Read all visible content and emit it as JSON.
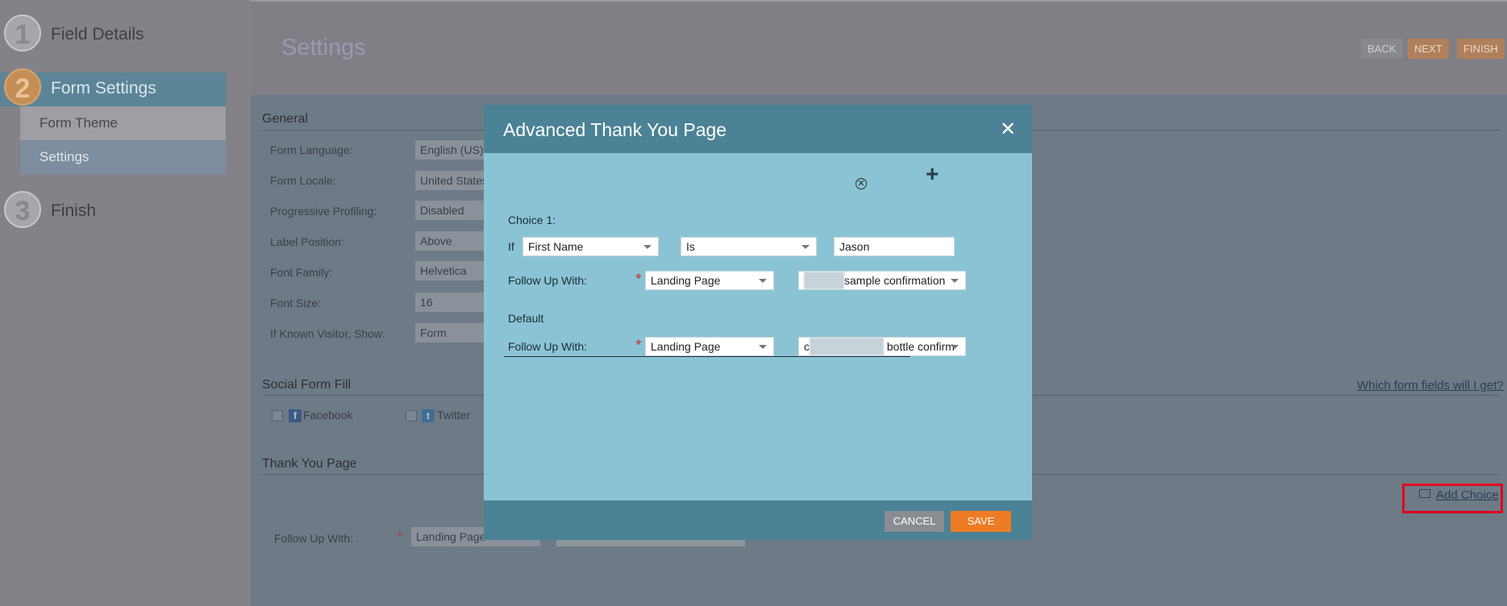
{
  "sidebar": {
    "steps": [
      {
        "number": "1",
        "label": "Field Details"
      },
      {
        "number": "2",
        "label": "Form Settings"
      },
      {
        "number": "3",
        "label": "Finish"
      }
    ],
    "sub_items": [
      "Form Theme",
      "Settings"
    ]
  },
  "header": {
    "title": "Settings",
    "back_label": "BACK",
    "next_label": "NEXT",
    "finish_label": "FINISH"
  },
  "general": {
    "title": "General",
    "fields": [
      {
        "label": "Form Language:",
        "value": "English (US)"
      },
      {
        "label": "Form Locale:",
        "value": "United States"
      },
      {
        "label": "Progressive Profiling:",
        "value": "Disabled"
      },
      {
        "label": "Label Position:",
        "value": "Above"
      },
      {
        "label": "Font Family:",
        "value": "Helvetica"
      },
      {
        "label": "Font Size:",
        "value": "16"
      },
      {
        "label": "If Known Visitor, Show:",
        "value": "Form"
      }
    ]
  },
  "social": {
    "title": "Social Form Fill",
    "link": "Which form fields will I get?",
    "facebook": "Facebook",
    "twitter": "Twitter"
  },
  "thank_you": {
    "title": "Thank You Page",
    "add_choice": "Add Choice",
    "follow_label": "Follow Up With:",
    "follow_value": "Landing Page"
  },
  "modal": {
    "title": "Advanced Thank You Page",
    "choice_label": "Choice 1:",
    "if_label": "If",
    "field_value": "First Name",
    "operator_value": "Is",
    "match_value": "Jason",
    "follow_label": "Follow Up With:",
    "follow_type": "Landing Page",
    "follow_page_suffix": "sample confirmation",
    "default_label": "Default",
    "default_follow_type": "Landing Page",
    "default_page_prefix": "c",
    "default_page_suffix": "bottle confirm",
    "cancel_label": "CANCEL",
    "save_label": "SAVE"
  }
}
